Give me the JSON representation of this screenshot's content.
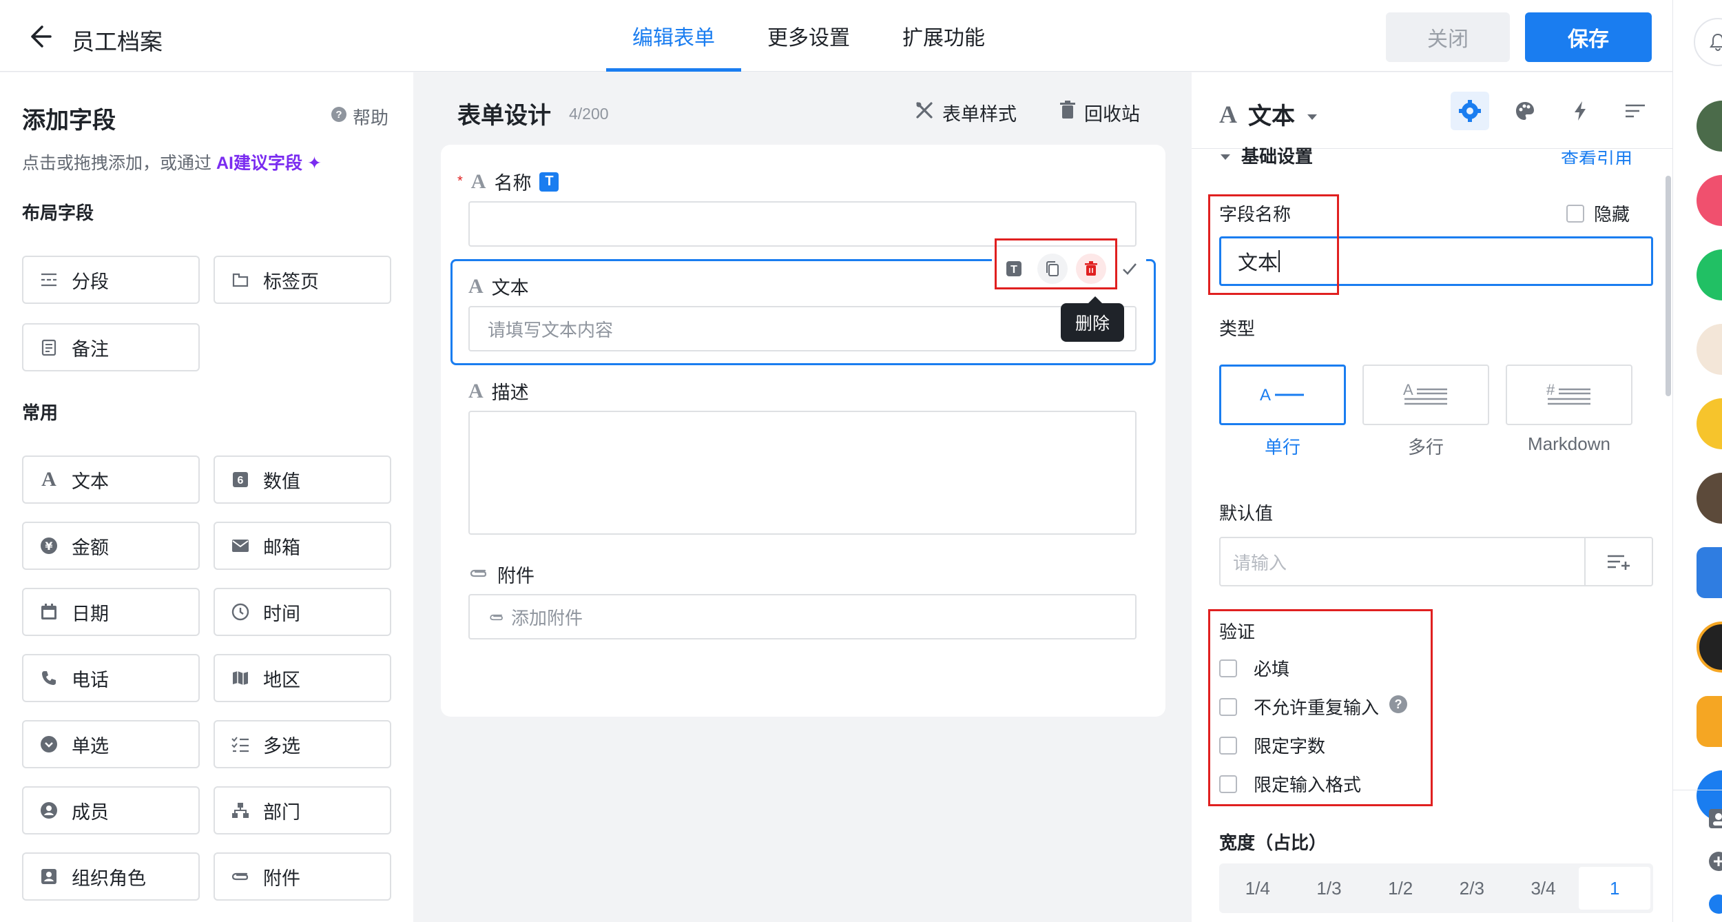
{
  "header": {
    "title": "员工档案",
    "tabs": [
      {
        "label": "编辑表单",
        "active": true
      },
      {
        "label": "更多设置",
        "active": false
      },
      {
        "label": "扩展功能",
        "active": false
      }
    ],
    "close_label": "关闭",
    "save_label": "保存"
  },
  "left_panel": {
    "title": "添加字段",
    "help_label": "帮助",
    "desc_prefix": "点击或拖拽添加，或通过",
    "ai_link": "AI建议字段",
    "sections": [
      {
        "title": "布局字段",
        "items": [
          {
            "label": "分段",
            "icon": "section-icon"
          },
          {
            "label": "标签页",
            "icon": "tab-page-icon"
          },
          {
            "label": "备注",
            "icon": "note-icon"
          }
        ]
      },
      {
        "title": "常用",
        "items": [
          {
            "label": "文本",
            "icon": "text-icon"
          },
          {
            "label": "数值",
            "icon": "number-icon"
          },
          {
            "label": "金额",
            "icon": "currency-icon"
          },
          {
            "label": "邮箱",
            "icon": "mail-icon"
          },
          {
            "label": "日期",
            "icon": "calendar-icon"
          },
          {
            "label": "时间",
            "icon": "clock-icon"
          },
          {
            "label": "电话",
            "icon": "phone-icon"
          },
          {
            "label": "地区",
            "icon": "map-icon"
          },
          {
            "label": "单选",
            "icon": "radio-icon"
          },
          {
            "label": "多选",
            "icon": "checklist-icon"
          },
          {
            "label": "成员",
            "icon": "member-icon"
          },
          {
            "label": "部门",
            "icon": "org-tree-icon"
          },
          {
            "label": "组织角色",
            "icon": "role-icon"
          },
          {
            "label": "附件",
            "icon": "attachment-icon"
          }
        ]
      }
    ]
  },
  "form_design": {
    "title": "表单设计",
    "count": "4/200",
    "style_label": "表单样式",
    "recycle_label": "回收站",
    "fields": [
      {
        "label": "名称",
        "required": true,
        "badge": "T",
        "placeholder": ""
      },
      {
        "label": "文本",
        "placeholder": "请填写文本内容"
      },
      {
        "label": "描述",
        "placeholder": ""
      },
      {
        "label": "附件",
        "placeholder": "添加附件"
      }
    ],
    "tooltip": "删除"
  },
  "props_panel": {
    "field_type": "文本",
    "section_title": "基础设置",
    "view_refs": "查看引用",
    "field_name_label": "字段名称",
    "hidden_label": "隐藏",
    "field_name_value": "文本",
    "type_label": "类型",
    "types": [
      {
        "label": "单行",
        "active": true
      },
      {
        "label": "多行",
        "active": false
      },
      {
        "label": "Markdown",
        "active": false
      }
    ],
    "default_label": "默认值",
    "default_placeholder": "请输入",
    "validation_label": "验证",
    "validations": [
      "必填",
      "不允许重复输入",
      "限定字数",
      "限定输入格式"
    ],
    "width_label": "宽度（占比）",
    "widths": [
      {
        "label": "1/4",
        "active": false
      },
      {
        "label": "1/3",
        "active": false
      },
      {
        "label": "1/2",
        "active": false
      },
      {
        "label": "2/3",
        "active": false
      },
      {
        "label": "3/4",
        "active": false
      },
      {
        "label": "1",
        "active": true
      }
    ]
  },
  "colors": {
    "accent": "#1a7df0",
    "danger": "#e02020",
    "ai": "#7a2cf0"
  }
}
